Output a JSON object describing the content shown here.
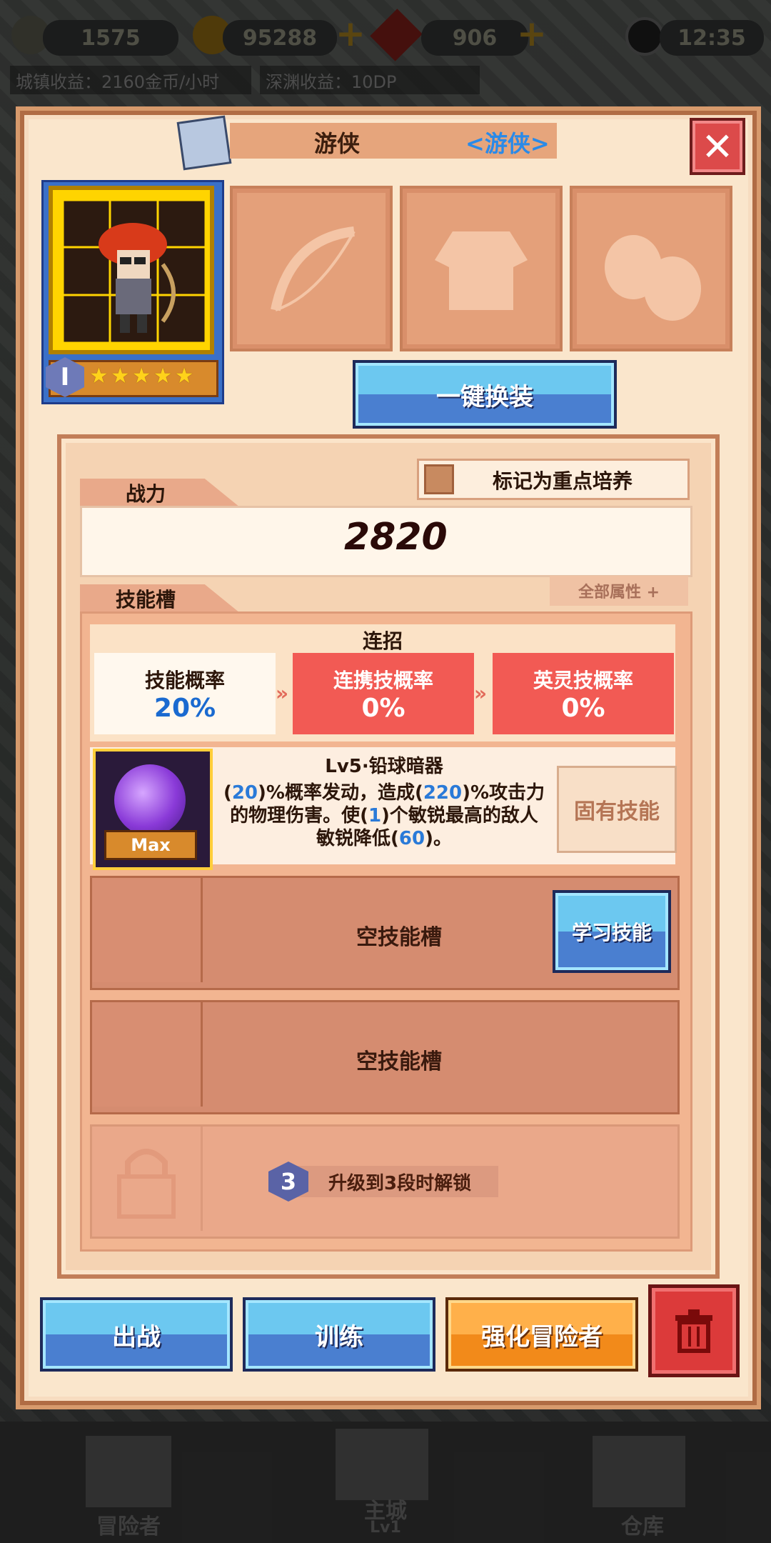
{
  "topbar": {
    "stat1": "1575",
    "gold": "95288",
    "gem": "906",
    "time": "12:35",
    "city_income": "城镇收益：2160金币/小时",
    "abyss_income": "深渊收益：10DP"
  },
  "hero": {
    "name": "游侠",
    "class_tag": "<游侠>",
    "rank": "I",
    "stars": "★★★★★"
  },
  "buttons": {
    "quick_equip": "一键换装",
    "mark_focus": "标记为重点培养",
    "all_attr": "全部属性 +",
    "learn_skill": "学习技能",
    "deploy": "出战",
    "train": "训练",
    "enhance": "强化冒险者"
  },
  "power": {
    "label": "战力",
    "value": "2820"
  },
  "skills": {
    "label": "技能槽",
    "combo_title": "连招",
    "probs": [
      {
        "name": "技能概率",
        "value": "20%"
      },
      {
        "name": "连携技概率",
        "value": "0%"
      },
      {
        "name": "英灵技概率",
        "value": "0%"
      }
    ],
    "skill1": {
      "name": "Lv5·铅球暗器",
      "max": "Max",
      "desc_a": "(",
      "n1": "20",
      "desc_b": ")%概率发动，造成(",
      "n2": "220",
      "desc_c": ")%攻击力",
      "desc_d": "的物理伤害。使(",
      "n3": "1",
      "desc_e": ")个敏锐最高的敌人",
      "desc_f": "敏锐降低(",
      "n4": "60",
      "desc_g": ")。",
      "type": "固有技能"
    },
    "empty_slot": "空技能槽",
    "unlock_level": "3",
    "unlock_text": "升级到3段时解锁"
  },
  "bottom_nav": {
    "adventurer": "冒险者",
    "city": "主城",
    "city_lv": "Lv1",
    "warehouse": "仓库"
  },
  "colors": {
    "panel": "#fae6cc",
    "red": "#f25a54",
    "blue": "#4a7fd0",
    "orange": "#f28a1a"
  }
}
